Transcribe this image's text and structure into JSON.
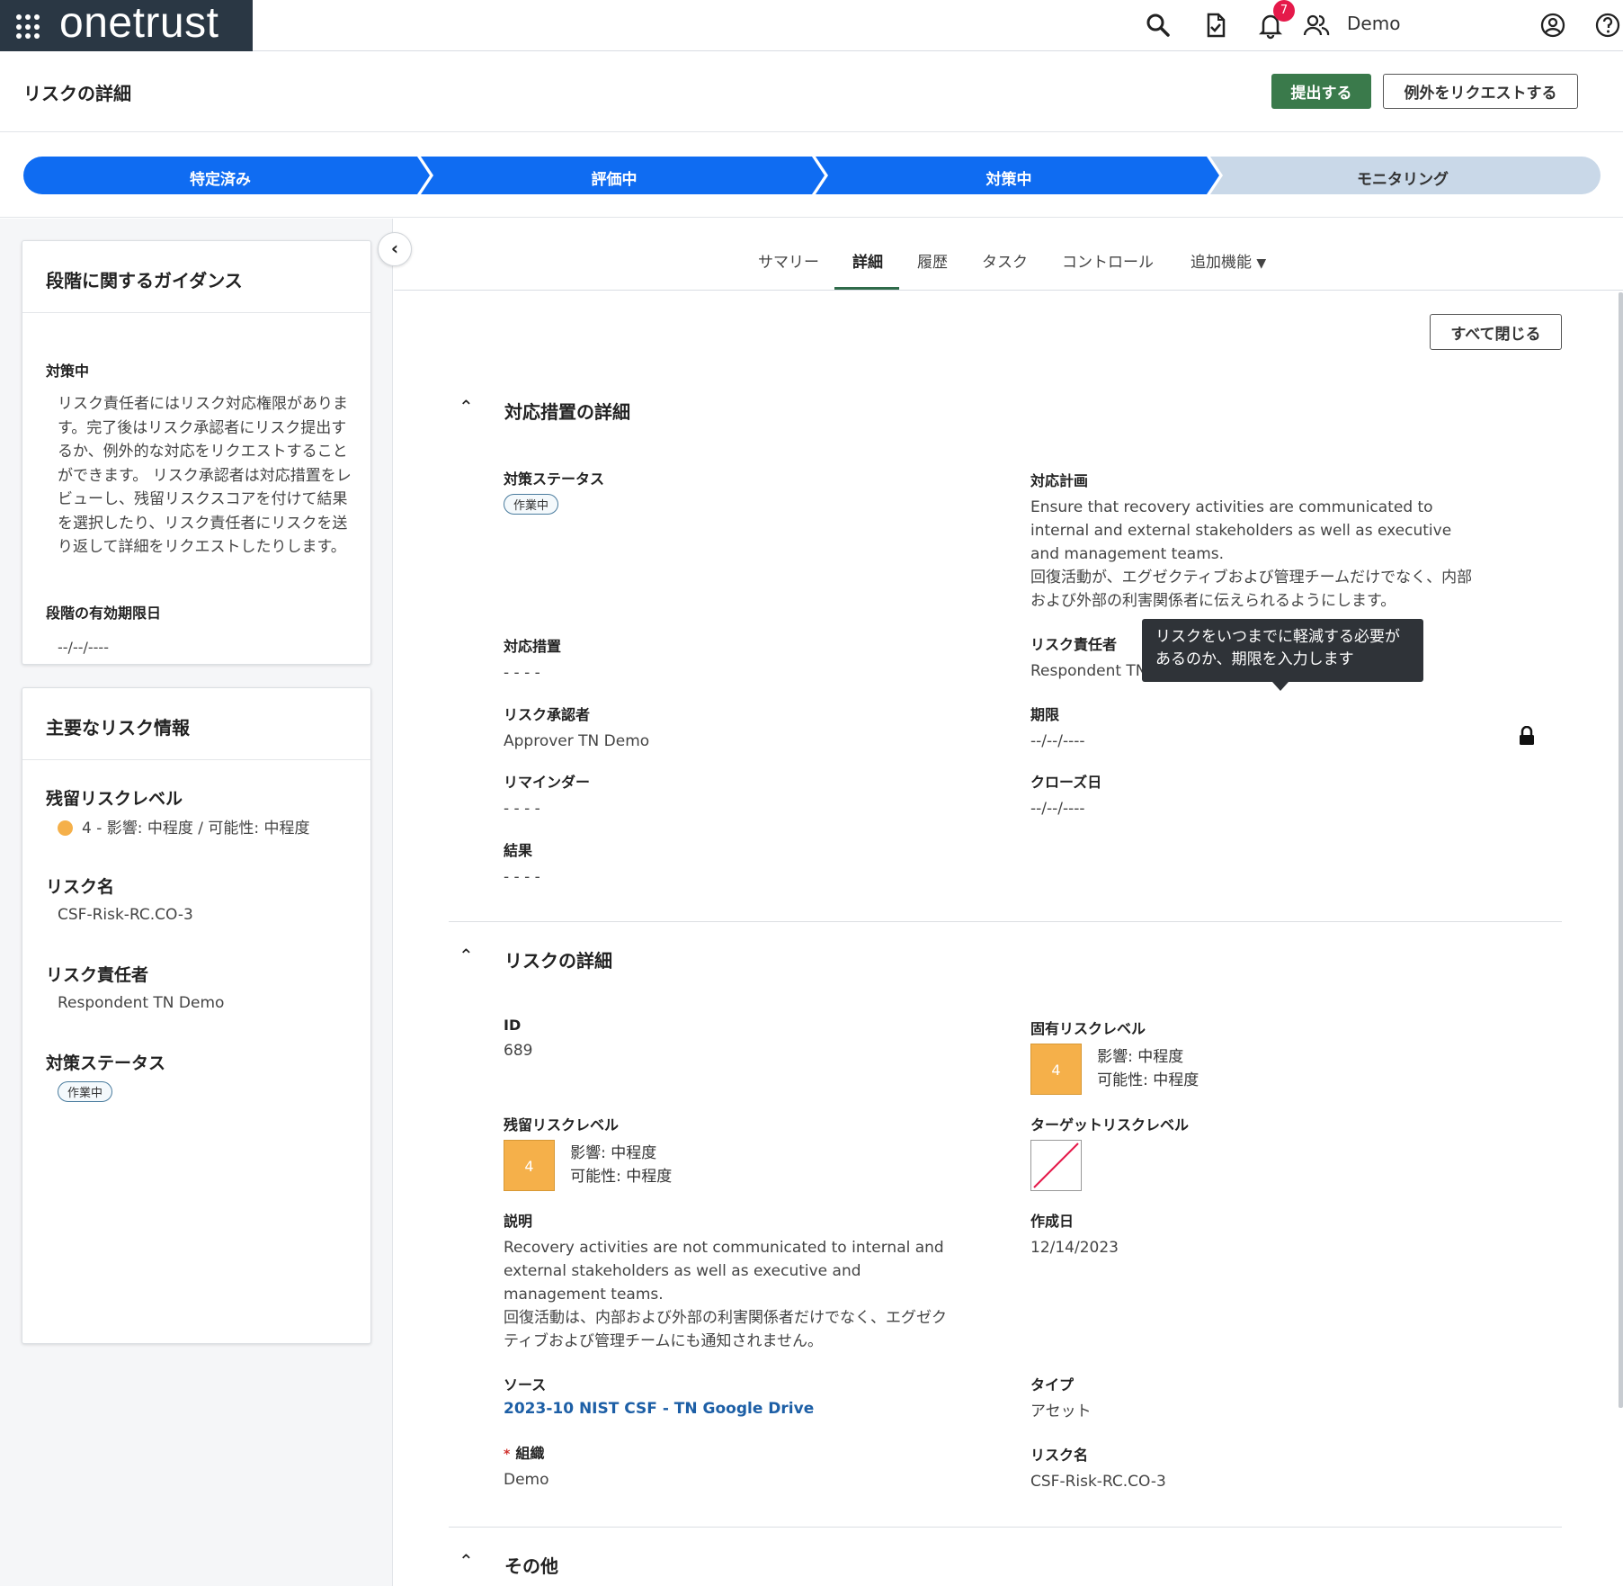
{
  "app": {
    "brand": "onetrust",
    "user": "Demo",
    "notifications_count": "7"
  },
  "header": {
    "title": "リスクの詳細",
    "submit_label": "提出する",
    "exception_label": "例外をリクエストする"
  },
  "stages": [
    {
      "label": "特定済み",
      "state": "complete"
    },
    {
      "label": "評価中",
      "state": "complete"
    },
    {
      "label": "対策中",
      "state": "current"
    },
    {
      "label": "モニタリング",
      "state": "pending"
    }
  ],
  "guidance": {
    "title": "段階に関するガイダンス",
    "stage_name": "対策中",
    "text": "リスク責任者にはリスク対応権限があります。完了後はリスク承認者にリスク提出するか、例外的な対応をリクエストすることができます。 リスク承認者は対応措置をレビューし、残留リスクスコアを付けて結果を選択したり、リスク責任者にリスクを送り返して詳細をリクエストしたりします。",
    "deadline_label": "段階の有効期限日",
    "deadline_value": "--/--/----"
  },
  "key_info": {
    "title": "主要なリスク情報",
    "residual_label": "残留リスクレベル",
    "residual_value": "4 - 影響: 中程度 / 可能性: 中程度",
    "name_label": "リスク名",
    "name_value": "CSF-Risk-RC.CO-3",
    "owner_label": "リスク責任者",
    "owner_value": "Respondent TN Demo",
    "status_label": "対策ステータス",
    "status_value": "作業中"
  },
  "tabs": [
    "サマリー",
    "詳細",
    "履歴",
    "タスク",
    "コントロール",
    "追加機能"
  ],
  "close_all_label": "すべて閉じる",
  "treatment": {
    "title": "対応措置の詳細",
    "status_label": "対策ステータス",
    "status_value": "作業中",
    "plan_label": "対応計画",
    "plan_en": "Ensure that recovery activities are communicated to internal and external stakeholders as well as executive and management teams.",
    "plan_ja": "回復活動が、エグゼクティブおよび管理チームだけでなく、内部および外部の利害関係者に伝えられるようにします。",
    "measure_label": "対応措置",
    "measure_value": "- - - -",
    "owner_label": "リスク責任者",
    "owner_value": "Respondent TN",
    "approver_label": "リスク承認者",
    "approver_value": "Approver TN Demo",
    "deadline_label": "期限",
    "deadline_value": "--/--/----",
    "reminder_label": "リマインダー",
    "reminder_value": "- - - -",
    "close_label": "クローズ日",
    "close_value": "--/--/----",
    "result_label": "結果",
    "result_value": "- - - -",
    "tooltip": "リスクをいつまでに軽減する必要があるのか、期限を入力します"
  },
  "risk_details": {
    "title": "リスクの詳細",
    "id_label": "ID",
    "id_value": "689",
    "inherent_label": "固有リスクレベル",
    "inherent_score": "4",
    "inherent_impact": "影響: 中程度",
    "inherent_likelihood": "可能性: 中程度",
    "residual_label": "残留リスクレベル",
    "residual_score": "4",
    "residual_impact": "影響: 中程度",
    "residual_likelihood": "可能性: 中程度",
    "target_label": "ターゲットリスクレベル",
    "desc_label": "説明",
    "desc_en": "Recovery activities are not communicated to internal and external stakeholders as well as executive and management teams.",
    "desc_ja": "回復活動は、内部および外部の利害関係者だけでなく、エグゼクティブおよび管理チームにも通知されません。",
    "created_label": "作成日",
    "created_value": "12/14/2023",
    "source_label": "ソース",
    "source_value": "2023-10 NIST CSF - TN Google Drive",
    "type_label": "タイプ",
    "type_value": "アセット",
    "org_label": "組織",
    "org_value": "Demo",
    "name_label": "リスク名",
    "name_value": "CSF-Risk-RC.CO-3"
  },
  "other": {
    "title": "その他"
  },
  "colors": {
    "stage_active": "#0f6cf2",
    "stage_pending": "#c9d8e8",
    "submit": "#3a7a4b",
    "score": "#f5b04a"
  }
}
